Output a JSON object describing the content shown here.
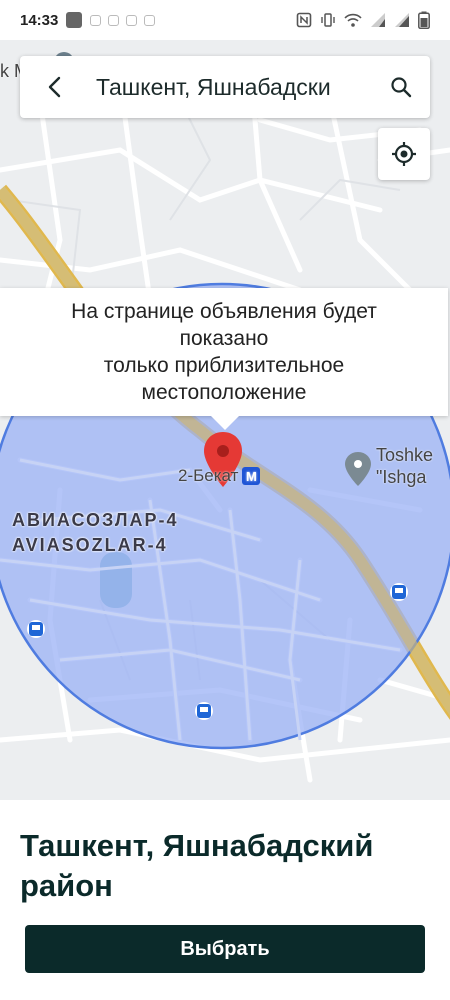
{
  "status_bar": {
    "time": "14:33"
  },
  "search": {
    "text": "Ташкент, Яшнабадски"
  },
  "map": {
    "tooltip_lines": [
      "На странице объявления будет",
      "показано",
      "только приблизительное",
      "местоположение"
    ],
    "district_label_line1": "АВИАСОЗЛАР-4",
    "district_label_line2": "AVIASOZLAR-4",
    "metro_label": "2-Бекат",
    "metro_badge": "M",
    "poi_line1": "Toshke",
    "poi_line2": "\"Ishga",
    "edge_label": "k M"
  },
  "bottom": {
    "location_title": "Ташкент, Яшнабадский район",
    "select_label": "Выбрать"
  },
  "colors": {
    "circle_fill": "#9bb2f5",
    "circle_stroke": "#4f7ce0",
    "pin": "#e53935",
    "button_bg": "#0b2a2a",
    "road_major": "#f6d36a"
  }
}
